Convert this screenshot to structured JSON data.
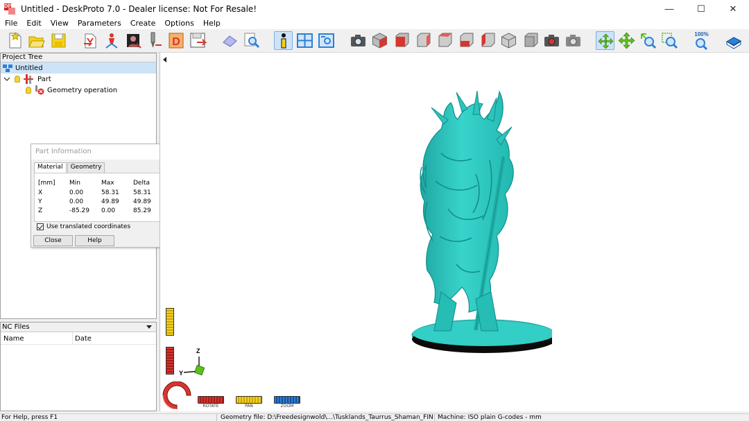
{
  "window": {
    "title": "Untitled - DeskProto 7.0 - Dealer license: Not For Resale!",
    "logo_letters": "DP",
    "minimize_glyph": "—",
    "maximize_glyph": "☐",
    "close_glyph": "✕"
  },
  "menu": [
    "File",
    "Edit",
    "View",
    "Parameters",
    "Create",
    "Options",
    "Help"
  ],
  "toolbar": {
    "zoom_label": "100%",
    "active_tool": "part-information-button",
    "colors": {
      "blue": "#2f7fd6",
      "red": "#d8352f",
      "yellow": "#f5d21c",
      "green": "#5cc21a",
      "gray": "#9a9a9a"
    }
  },
  "project_tree": {
    "header": "Project Tree",
    "root": "Untitled",
    "part": "Part",
    "operation": "Geometry operation"
  },
  "part_info": {
    "title": "Part Information",
    "tabs": [
      "Material",
      "Geometry"
    ],
    "active_tab": "Material",
    "columns": [
      "[mm]",
      "Min",
      "Max",
      "Delta"
    ],
    "rows": [
      {
        "axis": "X",
        "min": "0.00",
        "max": "58.31",
        "delta": "58.31"
      },
      {
        "axis": "Y",
        "min": "0.00",
        "max": "49.89",
        "delta": "49.89"
      },
      {
        "axis": "Z",
        "min": "-85.29",
        "max": "0.00",
        "delta": "85.29"
      }
    ],
    "checkbox_label": "Use translated coordinates",
    "checkbox_checked": true,
    "close_label": "Close",
    "help_label": "Help"
  },
  "nc_files": {
    "header": "NC Files",
    "columns": [
      "Name",
      "Date"
    ]
  },
  "viewport": {
    "model_color": "#2fc8c0",
    "axes": {
      "z": "Z",
      "y": "Y"
    },
    "mouse_functions": [
      {
        "label": "ROTATE",
        "color": "#d8352f"
      },
      {
        "label": "PAN",
        "color": "#f5d21c"
      },
      {
        "label": "ZOOM",
        "color": "#2f7fd6"
      }
    ]
  },
  "statusbar": {
    "help": "For Help, press F1",
    "geometry_file": "Geometry file: D:\\Freedesignwold\\...\\Tusklands_Taurrus_Shaman_FINAL.stl",
    "machine": "Machine: ISO plain G-codes - mm"
  }
}
